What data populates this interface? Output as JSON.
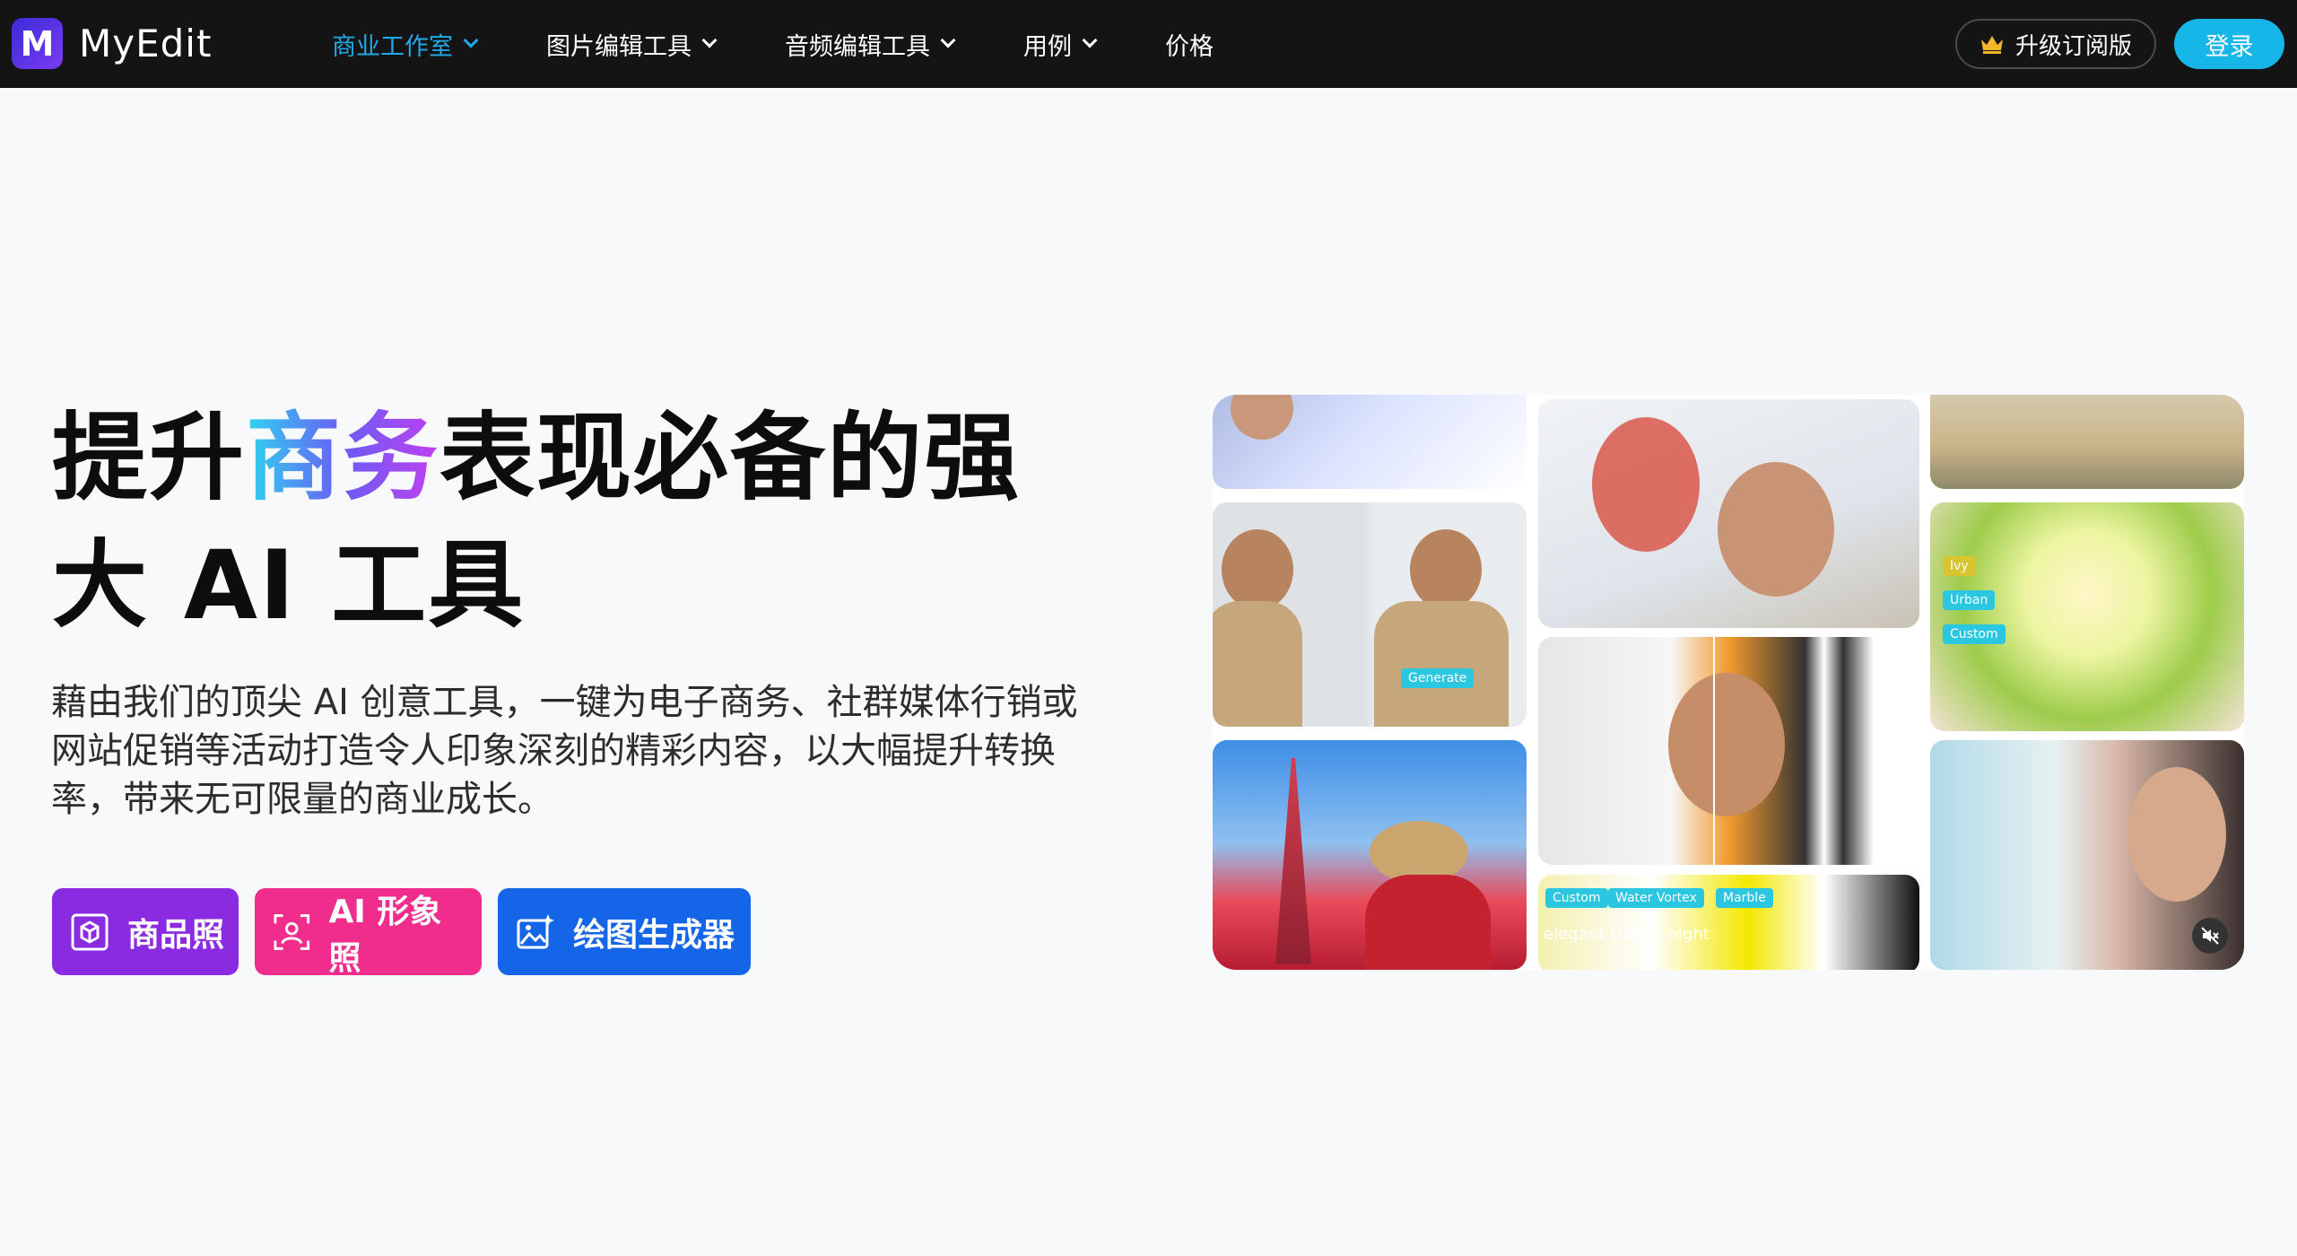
{
  "brand": {
    "name": "MyEdit"
  },
  "nav": {
    "items": [
      {
        "label": "商业工作室",
        "active": true,
        "has_dropdown": true
      },
      {
        "label": "图片编辑工具",
        "active": false,
        "has_dropdown": true
      },
      {
        "label": "音频编辑工具",
        "active": false,
        "has_dropdown": true
      },
      {
        "label": "用例",
        "active": false,
        "has_dropdown": true
      },
      {
        "label": "价格",
        "active": false,
        "has_dropdown": false
      }
    ],
    "upgrade_label": "升级订阅版",
    "login_label": "登录"
  },
  "hero": {
    "headline_part1": "提升",
    "headline_highlight": "商务",
    "headline_part2": "表现必备的强",
    "headline_line2": "大 AI 工具",
    "description": "藉由我们的顶尖 AI 创意工具，一键为电子商务、社群媒体行销或网站促销等活动打造令人印象深刻的精彩内容，以大幅提升转换率，带来无可限量的商业成长。",
    "buttons": [
      {
        "label": "商品照",
        "icon": "product-photo-icon",
        "color": "#8a2be2"
      },
      {
        "label": "AI 形象照",
        "icon": "ai-portrait-icon",
        "color": "#f02c8c"
      },
      {
        "label": "绘图生成器",
        "icon": "image-generator-icon",
        "color": "#1565e8"
      }
    ]
  },
  "collage": {
    "tags": {
      "generate": "Generate",
      "ivy": "Ivy",
      "urban": "Urban",
      "custom": "Custom",
      "custom2": "Custom",
      "water_vortex": "Water Vortex",
      "marble": "Marble"
    },
    "caption": "elegant slab in night"
  },
  "colors": {
    "nav_bg": "#141414",
    "accent": "#22a9e8",
    "login_bg": "#16b6e8"
  }
}
